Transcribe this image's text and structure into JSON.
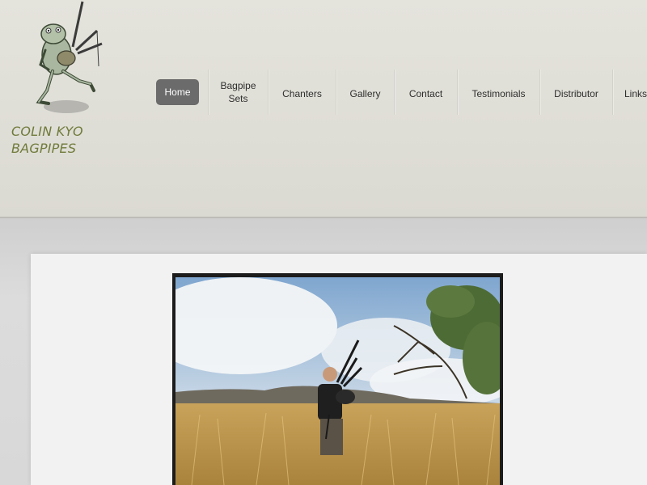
{
  "logo": {
    "line1": "COLIN KYO",
    "line2": "BAGPIPES",
    "icon": "frog-bagpiper-icon"
  },
  "nav": {
    "items": [
      {
        "label": "Home",
        "active": true
      },
      {
        "label": "Bagpipe\nSets",
        "active": false
      },
      {
        "label": "Chanters",
        "active": false
      },
      {
        "label": "Gallery",
        "active": false
      },
      {
        "label": "Contact",
        "active": false
      },
      {
        "label": "Testimonials",
        "active": false
      },
      {
        "label": "Distributor",
        "active": false
      },
      {
        "label": "Links",
        "active": false
      }
    ]
  },
  "colors": {
    "accent_logo": "#6f7a3a",
    "nav_active_bg": "#6b6b6b",
    "header_bg": "#e1e0d8"
  },
  "hero": {
    "icon": "bagpiper-photo"
  }
}
